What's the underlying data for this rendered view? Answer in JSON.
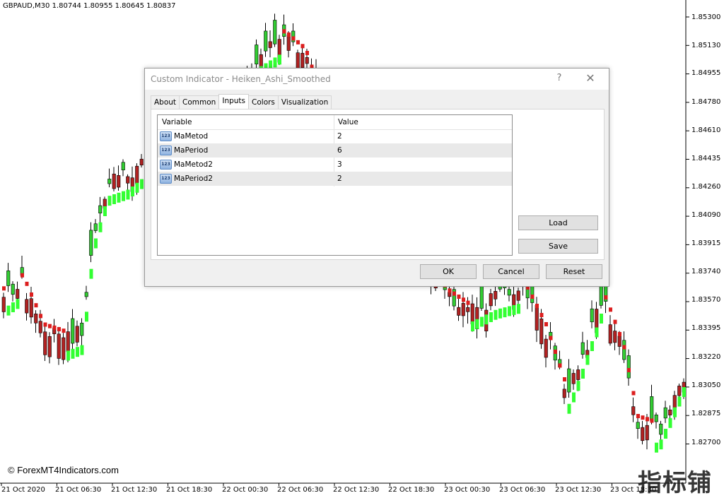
{
  "chart": {
    "symbol_header": "GBPAUD,M30  1.80744 1.80955 1.80645 1.80837",
    "copyright": "© ForexMT4Indicators.com",
    "watermark": "指标铺",
    "price_axis": [
      "1.85300",
      "1.85130",
      "1.84955",
      "1.84780",
      "1.84610",
      "1.84435",
      "1.84260",
      "1.84090",
      "1.83915",
      "1.83740",
      "1.83570",
      "1.83395",
      "1.83220",
      "1.83050",
      "1.82875",
      "1.82700"
    ],
    "time_axis": [
      "21 Oct 2020",
      "21 Oct 06:30",
      "21 Oct 12:30",
      "21 Oct 18:30",
      "22 Oct 00:30",
      "22 Oct 06:30",
      "22 Oct 12:30",
      "22 Oct 18:30",
      "23 Oct 00:30",
      "23 Oct 06:30",
      "23 Oct 12:30",
      "23 Oct 18:30"
    ],
    "colors": {
      "bull": "#32cd32",
      "bear": "#b22222",
      "ha_up": "#33ff33",
      "ha_down": "#dc1e1e",
      "wick": "#000000"
    }
  },
  "dialog": {
    "title": "Custom Indicator - Heiken_Ashi_Smoothed",
    "help_label": "?",
    "close_label": "✕",
    "tabs": [
      "About",
      "Common",
      "Inputs",
      "Colors",
      "Visualization"
    ],
    "active_tab": "Inputs",
    "grid": {
      "headers": [
        "Variable",
        "Value"
      ],
      "icon_label": "123",
      "rows": [
        {
          "variable": "MaMetod",
          "value": "2"
        },
        {
          "variable": "MaPeriod",
          "value": "6"
        },
        {
          "variable": "MaMetod2",
          "value": "3"
        },
        {
          "variable": "MaPeriod2",
          "value": "2"
        }
      ]
    },
    "buttons": {
      "load": "Load",
      "save": "Save",
      "ok": "OK",
      "cancel": "Cancel",
      "reset": "Reset"
    }
  }
}
